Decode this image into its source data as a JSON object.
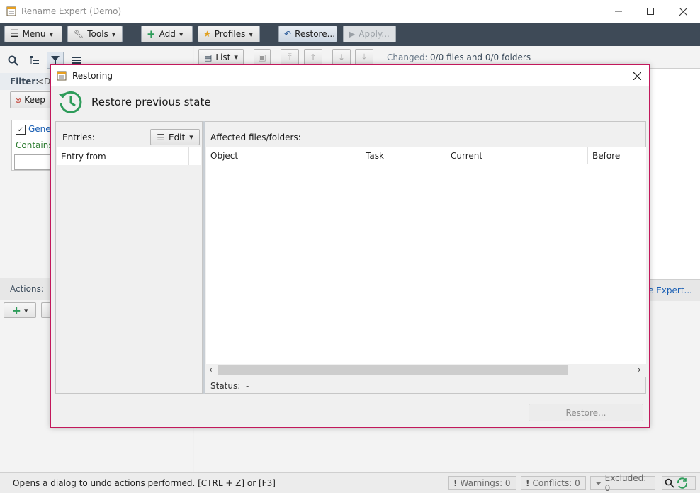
{
  "window": {
    "title": "Rename Expert (Demo)"
  },
  "toolbar": {
    "menu": "Menu",
    "tools": "Tools",
    "add": "Add",
    "profiles": "Profiles",
    "restore": "Restore...",
    "apply": "Apply..."
  },
  "left_panel": {
    "filter_label": "Filter:",
    "filter_value": "<De",
    "keep_button": "Keep",
    "general_checkbox": "Gener",
    "contains_label": "Contains",
    "actions_label": "Actions:"
  },
  "right_panel": {
    "list_button": "List",
    "changed_label": "Changed:",
    "changed_value": "0/0 files and 0/0 folders",
    "link_text": "e Expert..."
  },
  "dialog": {
    "title": "Restoring",
    "heading": "Restore previous state",
    "entries_label": "Entries:",
    "edit_button": "Edit",
    "entries_column": "Entry from",
    "affected_label": "Affected files/folders:",
    "columns": [
      "Object",
      "Task",
      "Current",
      "Before"
    ],
    "status_label": "Status:",
    "status_value": "-",
    "restore_button": "Restore..."
  },
  "statusbar": {
    "hint": "Opens a dialog to undo actions performed. [CTRL + Z] or [F3]",
    "warnings": "Warnings: 0",
    "conflicts": "Conflicts: 0",
    "excluded": "Excluded: 0"
  },
  "colors": {
    "toolbar_bg": "#3e4a57",
    "dialog_border": "#c2185b",
    "accent_green": "#2e9c5a",
    "link_blue": "#1a5fb4"
  }
}
